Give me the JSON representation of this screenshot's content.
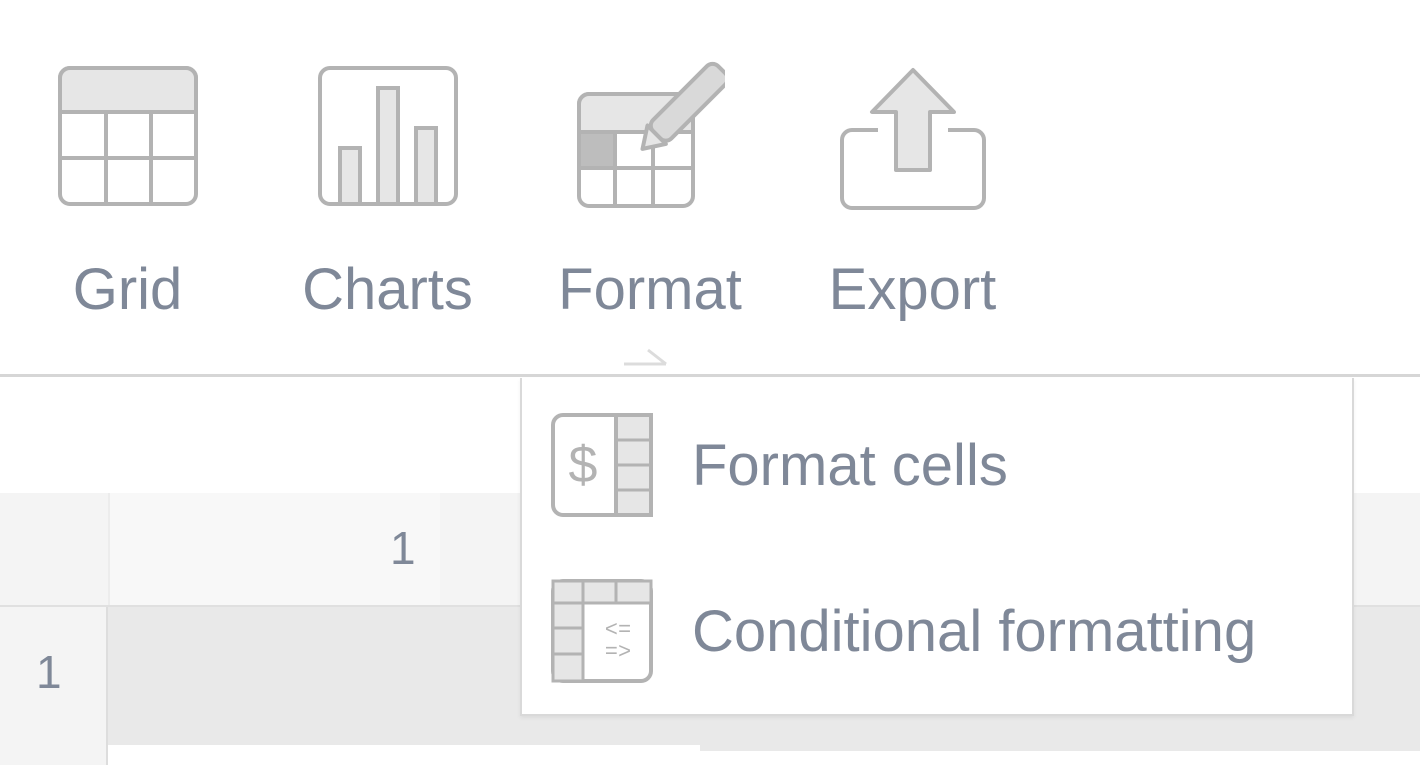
{
  "toolbar": {
    "items": [
      {
        "label": "Grid",
        "icon": "grid-icon"
      },
      {
        "label": "Charts",
        "icon": "charts-icon"
      },
      {
        "label": "Format",
        "icon": "format-icon"
      },
      {
        "label": "Export",
        "icon": "export-icon"
      }
    ]
  },
  "grid": {
    "column_headers": [
      "1"
    ],
    "row_headers": [
      "1"
    ]
  },
  "format_menu": {
    "items": [
      {
        "label": "Format cells",
        "icon": "format-cells-icon"
      },
      {
        "label": "Conditional formatting",
        "icon": "conditional-formatting-icon"
      }
    ]
  },
  "colors": {
    "icon_stroke": "#a8a8a8",
    "icon_fill": "#e6e6e6",
    "text": "#7f8898",
    "border": "#d6d6d6"
  }
}
